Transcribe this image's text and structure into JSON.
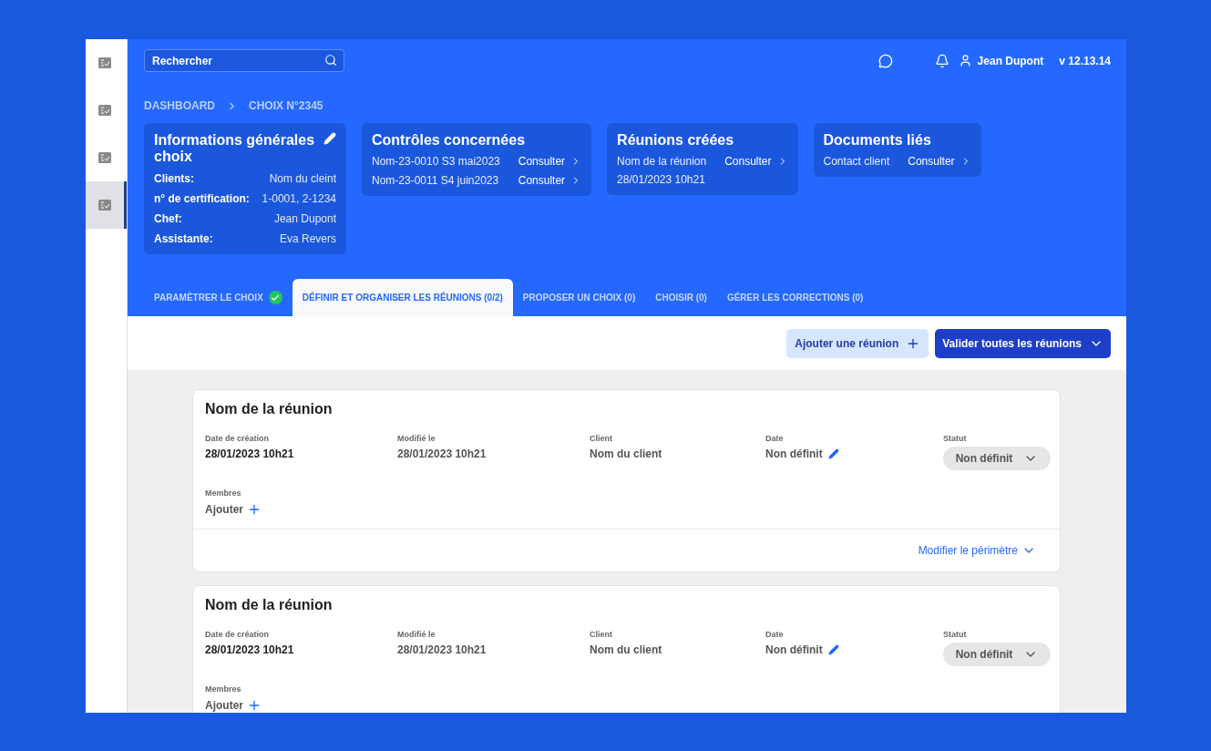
{
  "sidebar": {
    "items": [
      {
        "selected": false
      },
      {
        "selected": false
      },
      {
        "selected": false
      },
      {
        "selected": true
      }
    ]
  },
  "topbar": {
    "search_placeholder": "Rechercher",
    "user": "Jean Dupont",
    "version": "v 12.13.14"
  },
  "breadcrumb": [
    "DASHBOARD",
    "CHOIX N°2345"
  ],
  "info_card": {
    "title": "Informations générales choix",
    "fields": [
      {
        "label": "Clients:",
        "value": "Nom du cleint"
      },
      {
        "label": "n°  de certification:",
        "value": "1-0001, 2-1234"
      },
      {
        "label": "Chef:",
        "value": "Jean Dupont"
      },
      {
        "label": "Assistante:",
        "value": "Eva Revers"
      }
    ]
  },
  "link_cards": [
    {
      "title": "Contrôles concernées",
      "rows": [
        {
          "text": "Nom-23-0010 S3 mai2023",
          "link": "Consulter"
        },
        {
          "text": "Nom-23-0011 S4  juin2023",
          "link": "Consulter"
        }
      ]
    },
    {
      "title": "Réunions créées",
      "rows": [
        {
          "text": "Nom de la réunion",
          "link": "Consulter"
        }
      ],
      "note": "28/01/2023 10h21"
    },
    {
      "title": "Documents liés",
      "rows": [
        {
          "text": "Contact client",
          "link": "Consulter"
        }
      ]
    }
  ],
  "tabs": [
    {
      "label": "PARAMÈTRER LE CHOIX",
      "selected": false,
      "done": true
    },
    {
      "label": "DÉFINIR ET ORGANISER LES RÉUNIONS (0/2)",
      "selected": true,
      "done": false
    },
    {
      "label": "PROPOSER UN CHOIX (0)",
      "selected": false,
      "done": false
    },
    {
      "label": "CHOISIR (0)",
      "selected": false,
      "done": false
    },
    {
      "label": "GÉRER LES CORRECTIONS (0)",
      "selected": false,
      "done": false
    }
  ],
  "actions": {
    "add": "Ajouter une réunion",
    "validate": "Valider toutes les réunions"
  },
  "meetings": [
    {
      "title": "Nom de la réunion",
      "fields": [
        {
          "label": "Date de création",
          "value": "28/01/2023 10h21",
          "kind": "text"
        },
        {
          "label": "Modifié le",
          "value": "28/01/2023 10h21",
          "kind": "muted"
        },
        {
          "label": "Client",
          "value": "Nom du client",
          "kind": "muted"
        },
        {
          "label": "Date",
          "value": "Non définit",
          "kind": "editable"
        },
        {
          "label": "Statut",
          "value": "Non définit",
          "kind": "select"
        }
      ],
      "members_label": "Membres",
      "members_action": "Ajouter",
      "footer_link": "Modifier le périmètre"
    },
    {
      "title": "Nom de la réunion",
      "fields": [
        {
          "label": "Date de création",
          "value": "28/01/2023 10h21",
          "kind": "text"
        },
        {
          "label": "Modifié le",
          "value": "28/01/2023 10h21",
          "kind": "muted"
        },
        {
          "label": "Client",
          "value": "Nom du client",
          "kind": "muted"
        },
        {
          "label": "Date",
          "value": "Non définit",
          "kind": "editable"
        },
        {
          "label": "Statut",
          "value": "Non définit",
          "kind": "select"
        }
      ],
      "members_label": "Membres",
      "members_action": "Ajouter"
    }
  ]
}
